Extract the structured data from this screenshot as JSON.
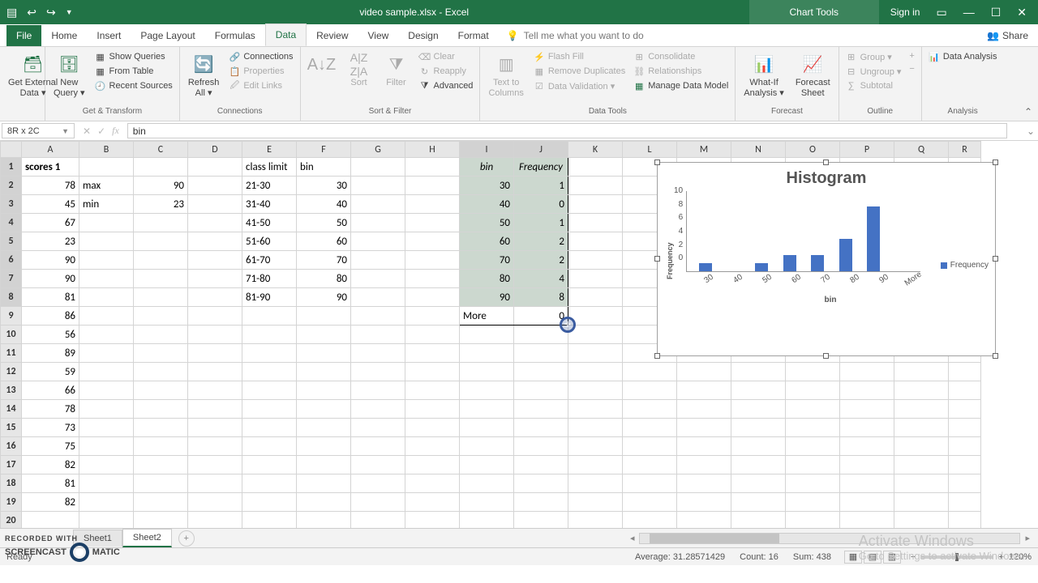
{
  "title": {
    "doc": "video sample.xlsx - Excel",
    "chart_tools": "Chart Tools",
    "signin": "Sign in"
  },
  "tabs": {
    "file": "File",
    "home": "Home",
    "insert": "Insert",
    "page": "Page Layout",
    "formulas": "Formulas",
    "data": "Data",
    "review": "Review",
    "view": "View",
    "design": "Design",
    "format": "Format",
    "tellme": "Tell me what you want to do",
    "share": "Share"
  },
  "ribbon": {
    "get_external": "Get External\nData ▾",
    "new_query": "New\nQuery ▾",
    "show_queries": "Show Queries",
    "from_table": "From Table",
    "recent": "Recent Sources",
    "refresh": "Refresh\nAll ▾",
    "connections": "Connections",
    "properties": "Properties",
    "edit_links": "Edit Links",
    "sort": "Sort",
    "filter": "Filter",
    "clear": "Clear",
    "reapply": "Reapply",
    "advanced": "Advanced",
    "text_cols": "Text to\nColumns",
    "flash": "Flash Fill",
    "remove_dup": "Remove Duplicates",
    "validation": "Data Validation ▾",
    "consolidate": "Consolidate",
    "relationships": "Relationships",
    "model": "Manage Data Model",
    "whatif": "What-If\nAnalysis ▾",
    "forecast": "Forecast\nSheet",
    "group": "Group ▾",
    "ungroup": "Ungroup ▾",
    "subtotal": "Subtotal",
    "analysis": "Data Analysis",
    "g1": "Get & Transform",
    "g2": "Connections",
    "g3": "Sort & Filter",
    "g4": "Data Tools",
    "g5": "Forecast",
    "g6": "Outline",
    "g7": "Analysis"
  },
  "name_box": "8R x 2C",
  "formula": "bin",
  "cols": [
    "A",
    "B",
    "C",
    "D",
    "E",
    "F",
    "G",
    "H",
    "I",
    "J",
    "K",
    "L",
    "M",
    "N",
    "O",
    "P",
    "Q",
    "R"
  ],
  "rows20": [
    1,
    2,
    3,
    4,
    5,
    6,
    7,
    8,
    9,
    10,
    11,
    12,
    13,
    14,
    15,
    16,
    17,
    18,
    19,
    20
  ],
  "cells": {
    "A1": "scores 1",
    "A2": "78",
    "A3": "45",
    "A4": "67",
    "A5": "23",
    "A6": "90",
    "A7": "90",
    "A8": "81",
    "A9": "86",
    "A10": "56",
    "A11": "89",
    "A12": "59",
    "A13": "66",
    "A14": "78",
    "A15": "73",
    "A16": "75",
    "A17": "82",
    "A18": "81",
    "A19": "82",
    "B2": "max",
    "B3": "min",
    "C2": "90",
    "C3": "23",
    "E1": "class limit",
    "F1": "bin",
    "E2": "21-30",
    "E3": "31-40",
    "E4": "41-50",
    "E5": "51-60",
    "E6": "61-70",
    "E7": "71-80",
    "E8": "81-90",
    "F2": "30",
    "F3": "40",
    "F4": "50",
    "F5": "60",
    "F6": "70",
    "F7": "80",
    "F8": "90",
    "I1": "bin",
    "J1": "Frequency",
    "I2": "30",
    "I3": "40",
    "I4": "50",
    "I5": "60",
    "I6": "70",
    "I7": "80",
    "I8": "90",
    "I9": "More",
    "J2": "1",
    "J3": "0",
    "J4": "1",
    "J5": "2",
    "J6": "2",
    "J7": "4",
    "J8": "8",
    "J9": "0"
  },
  "chart_data": {
    "type": "bar",
    "title": "Histogram",
    "xlabel": "bin",
    "ylabel": "Frequency",
    "categories": [
      "30",
      "40",
      "50",
      "60",
      "70",
      "80",
      "90",
      "More"
    ],
    "series": [
      {
        "name": "Frequency",
        "values": [
          1,
          0,
          1,
          2,
          2,
          4,
          8,
          0
        ]
      }
    ],
    "ylim": [
      0,
      10
    ],
    "yticks": [
      0,
      2,
      4,
      6,
      8,
      10
    ]
  },
  "sheets": {
    "s1": "Sheet1",
    "s2": "Sheet2"
  },
  "status": {
    "ready": "Ready",
    "avg_l": "Average:",
    "avg": "31.28571429",
    "cnt_l": "Count:",
    "cnt": "16",
    "sum_l": "Sum:",
    "sum": "438",
    "zoom": "120%"
  },
  "overlay": {
    "rec": "RECORDED WITH",
    "som": "SCREENCAST",
    "som2": "MATIC",
    "act": "Activate Windows",
    "act2": "Go to Settings to activate Windows."
  }
}
